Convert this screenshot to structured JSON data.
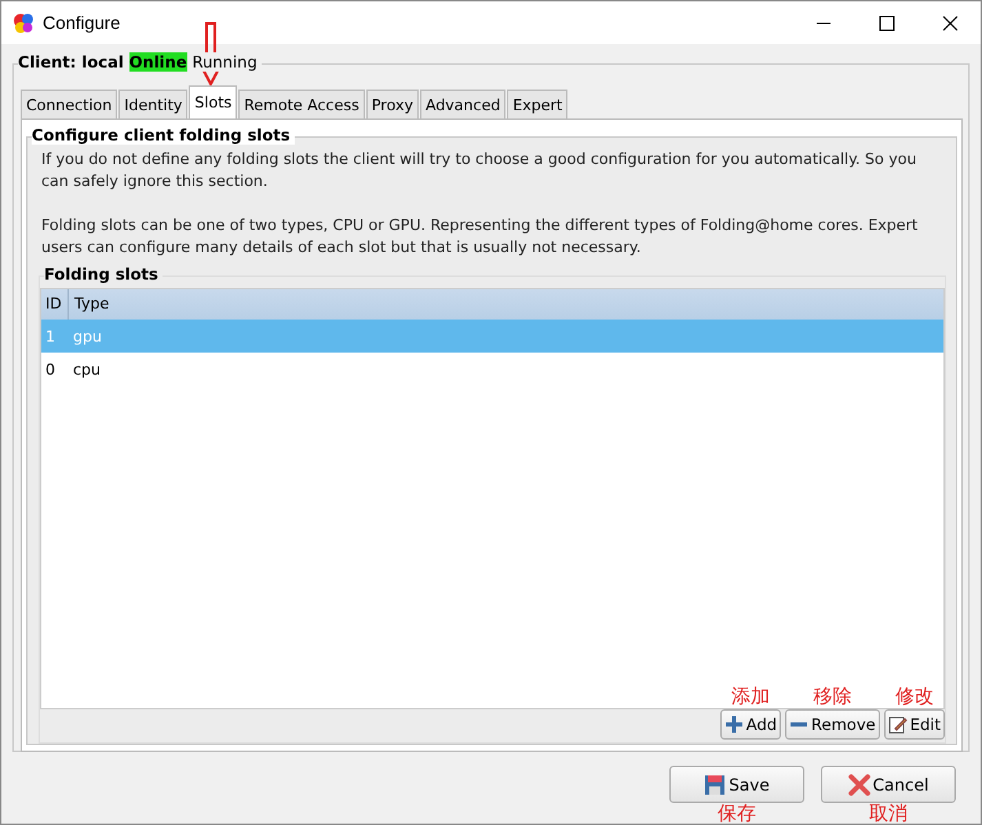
{
  "window": {
    "title": "Configure"
  },
  "client": {
    "label": "Client: local",
    "status": "Online",
    "state": "Running"
  },
  "tabs": [
    {
      "label": "Connection",
      "selected": false
    },
    {
      "label": "Identity",
      "selected": false
    },
    {
      "label": "Slots",
      "selected": true
    },
    {
      "label": "Remote Access",
      "selected": false
    },
    {
      "label": "Proxy",
      "selected": false
    },
    {
      "label": "Advanced",
      "selected": false
    },
    {
      "label": "Expert",
      "selected": false
    }
  ],
  "section": {
    "title": "Configure client folding slots",
    "paragraphs": [
      "If you do not define any folding slots the client will try to choose a good configuration for you automatically.  So you can safely ignore this section.",
      "Folding slots can be one of two types, CPU or GPU.  Representing the different types of Folding@home cores. Expert users can configure many details of each slot but that is usually not necessary."
    ]
  },
  "slots": {
    "title": "Folding slots",
    "columns": [
      "ID",
      "Type"
    ],
    "rows": [
      {
        "cells": [
          "1",
          "gpu"
        ],
        "selected": true
      },
      {
        "cells": [
          "0",
          "cpu"
        ],
        "selected": false
      }
    ],
    "buttons": [
      {
        "kind": "add",
        "label": "Add",
        "annotation": "添加"
      },
      {
        "kind": "remove",
        "label": "Remove",
        "annotation": "移除"
      },
      {
        "kind": "edit",
        "label": "Edit",
        "annotation": "修改"
      }
    ]
  },
  "footer_buttons": [
    {
      "kind": "save",
      "label": "Save",
      "annotation": "保存"
    },
    {
      "kind": "cancel",
      "label": "Cancel",
      "annotation": "取消"
    }
  ]
}
